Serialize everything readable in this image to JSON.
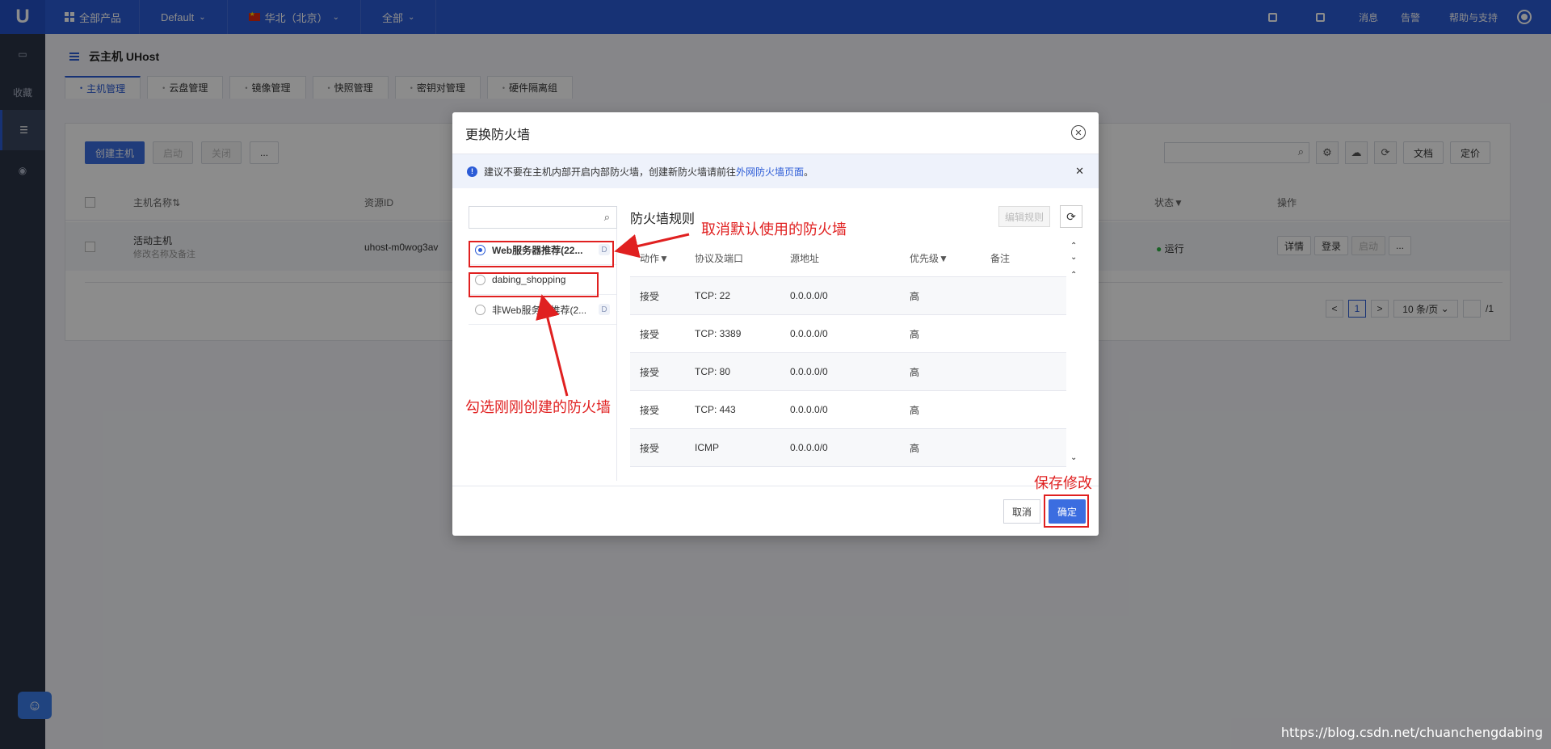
{
  "topbar": {
    "logo": "U",
    "all_products": "全部产品",
    "project": "Default",
    "region": "华北（北京）",
    "scope": "全部",
    "messages": "消息",
    "alarms": "告警",
    "help": "帮助与支持"
  },
  "sidebar": {
    "favorites": "收藏"
  },
  "page": {
    "title": "云主机 UHost",
    "tabs": [
      {
        "label": "主机管理"
      },
      {
        "label": "云盘管理"
      },
      {
        "label": "镜像管理"
      },
      {
        "label": "快照管理"
      },
      {
        "label": "密钥对管理"
      },
      {
        "label": "硬件隔离组"
      }
    ]
  },
  "panel": {
    "create_label": "创建主机",
    "start_label": "启动",
    "stop_label": "关闭",
    "more_label": "...",
    "docs_label": "文档",
    "pricing_label": "定价",
    "columns": {
      "name": "主机名称⇅",
      "resource_id": "资源ID",
      "status": "状态▼",
      "actions": "操作"
    },
    "row": {
      "name": "活动主机",
      "name_hint": "修改名称及备注",
      "resource_id": "uhost-m0wog3av",
      "status": "运行",
      "detail": "详情",
      "login": "登录",
      "start": "启动",
      "more": "..."
    },
    "pager": {
      "prev": "<",
      "current": "1",
      "next": ">",
      "page_size": "10 条/页",
      "total": "/1"
    }
  },
  "modal": {
    "title": "更换防火墙",
    "notice_prefix": "建议不要在主机内部开启内部防火墙，创建新防火墙请前往",
    "notice_link": "外网防火墙页面",
    "notice_suffix": "。",
    "firewalls": [
      {
        "name": "Web服务器推荐(22...",
        "tag": "D",
        "selected": true
      },
      {
        "name": "dabing_shopping",
        "tag": "",
        "selected": false
      },
      {
        "name": "非Web服务器推荐(2...",
        "tag": "D",
        "selected": false
      }
    ],
    "rules_title": "防火墙规则",
    "edit_rules": "编辑规则",
    "rule_columns": {
      "action": "动作▼",
      "protocol": "协议及端口",
      "source": "源地址",
      "priority": "优先级▼",
      "remark": "备注"
    },
    "rules": [
      {
        "action": "接受",
        "protocol": "TCP: 22",
        "source": "0.0.0.0/0",
        "priority": "高",
        "remark": ""
      },
      {
        "action": "接受",
        "protocol": "TCP: 3389",
        "source": "0.0.0.0/0",
        "priority": "高",
        "remark": ""
      },
      {
        "action": "接受",
        "protocol": "TCP: 80",
        "source": "0.0.0.0/0",
        "priority": "高",
        "remark": ""
      },
      {
        "action": "接受",
        "protocol": "TCP: 443",
        "source": "0.0.0.0/0",
        "priority": "高",
        "remark": ""
      },
      {
        "action": "接受",
        "protocol": "ICMP",
        "source": "0.0.0.0/0",
        "priority": "高",
        "remark": ""
      }
    ],
    "cancel_label": "取消",
    "ok_label": "确定"
  },
  "annotations": {
    "uncheck_default": "取消默认使用的防火墙",
    "select_new": "勾选刚刚创建的防火墙",
    "save": "保存修改"
  },
  "watermark": "https://blog.csdn.net/chuanchengdabing",
  "colors": {
    "brand": "#2b5bd6",
    "annotation": "#e02020",
    "status_running": "#2fb344"
  }
}
